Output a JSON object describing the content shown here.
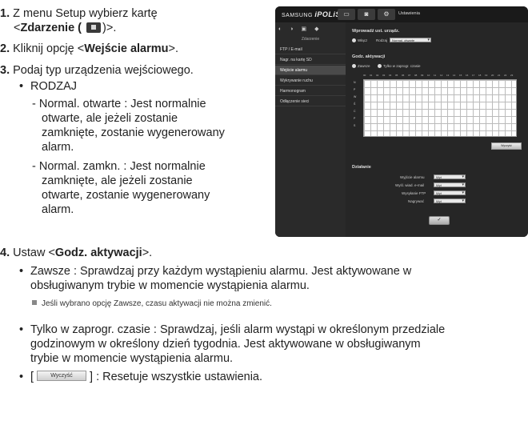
{
  "steps": [
    {
      "num": "1.",
      "line1": "Z menu Setup wybierz kartę",
      "line2_pre": "<",
      "line2_bold": "Zdarzenie (",
      "line2_post": ")>.",
      "icon": "event-tab-icon"
    },
    {
      "num": "2.",
      "pre": "Kliknij opcję <",
      "bold": "Wejście alarmu",
      "post": ">."
    },
    {
      "num": "3.",
      "text": "Podaj typ urządzenia wejściowego."
    },
    {
      "num": "4.",
      "pre": "Ustaw <",
      "bold": "Godz. aktywacji",
      "post": ">."
    }
  ],
  "rodzaj": {
    "heading": "RODZAJ",
    "open_lines": [
      "- Normal. otwarte : Jest normalnie",
      "otwarte, ale jeżeli zostanie",
      "zamknięte, zostanie wygenerowany",
      "alarm."
    ],
    "closed_lines": [
      "- Normal. zamkn. : Jest normalnie",
      "zamknięte, ale jeżeli zostanie",
      "otwarte, zostanie wygenerowany",
      "alarm."
    ]
  },
  "activation": {
    "always_lines": [
      "Zawsze : Sprawdzaj przy każdym wystąpieniu alarmu. Jest aktywowane w",
      "obsługiwanym trybie w momencie wystąpienia alarmu."
    ],
    "note": "Jeśli wybrano opcję Zawsze, czasu aktywacji nie można zmienić.",
    "scheduled_lines": [
      "Tylko w zaprogr. czasie : Sprawdzaj, jeśli alarm wystąpi w określonym przedziale",
      "godzinowym w określony dzień tygodnia. Jest aktywowane w obsługiwanym",
      "trybie w momencie wystąpienia alarmu."
    ],
    "reset_pre": "[",
    "reset_button": "Wyczyść",
    "reset_post": "] : Resetuje wszystkie ustawienia."
  },
  "screenshot": {
    "logo_brand": "SAMSUNG",
    "logo_product": "iPOLiS",
    "title": "Ustawienia",
    "menu": [
      "FTP / E-mail",
      "Nagr. na kartę SD",
      "Wejście alarmu",
      "Wykrywanie ruchu",
      "Harmonogram",
      "Odłączenie sieci"
    ],
    "active_menu_index": 2,
    "section1": "Wprowadź ust. urządz.",
    "enable_label": "Włącz",
    "type_label": "Rodzaj",
    "type_value": "Normal. otwarte",
    "section2": "Godz. aktywacji",
    "radio_always": "Zawsze",
    "radio_schedule": "Tylko w zaprogr. czasie",
    "hours": [
      "00",
      "01",
      "02",
      "03",
      "04",
      "05",
      "06",
      "07",
      "08",
      "09",
      "10",
      "11",
      "12",
      "13",
      "14",
      "15",
      "16",
      "17",
      "18",
      "19",
      "20",
      "21",
      "22",
      "23"
    ],
    "days": [
      "N",
      "P",
      "W",
      "Ś",
      "C",
      "P",
      "S"
    ],
    "clear_button": "Wyczyść",
    "section3": "Działanie",
    "actions": [
      {
        "label": "Wyjście alarmu",
        "value": "Wył"
      },
      {
        "label": "Wyśl. wiad. e-mail",
        "value": "Wył"
      },
      {
        "label": "Wysyłanie FTP",
        "value": "Wył"
      },
      {
        "label": "Nagrywać",
        "value": "Wył"
      }
    ],
    "ok_button": "✓"
  }
}
